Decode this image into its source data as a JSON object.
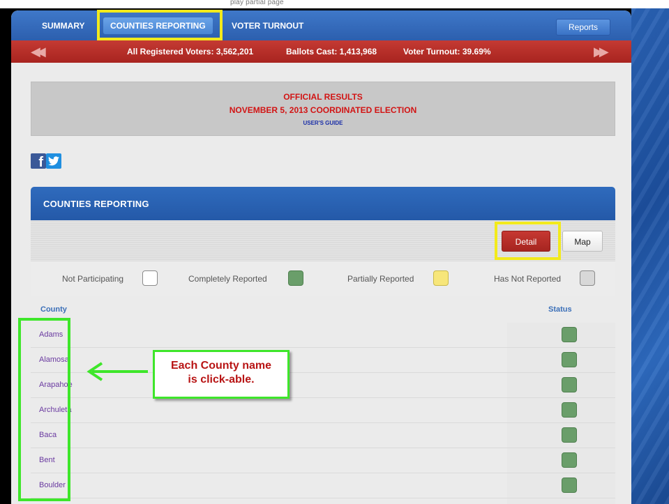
{
  "top_snippet": "play                                     partial page",
  "nav": {
    "items": [
      {
        "label": "SUMMARY"
      },
      {
        "label": "COUNTIES REPORTING"
      },
      {
        "label": "VOTER TURNOUT"
      }
    ],
    "active_index": 1,
    "reports_label": "Reports"
  },
  "stats_bar": {
    "registered": "All Registered Voters: 3,562,201",
    "ballots": "Ballots Cast: 1,413,968",
    "turnout": "Voter Turnout: 39.69%"
  },
  "banner": {
    "line1": "OFFICIAL RESULTS",
    "line2": "NOVEMBER 5, 2013 COORDINATED ELECTION",
    "guide": "USER'S GUIDE"
  },
  "counties_panel": {
    "title": "COUNTIES REPORTING",
    "detail_label": "Detail",
    "map_label": "Map",
    "legend": [
      {
        "label": "Not Participating",
        "color": "#ffffff"
      },
      {
        "label": "Completely Reported",
        "color": "#6a9e6a"
      },
      {
        "label": "Partially Reported",
        "color": "#f7e67a"
      },
      {
        "label": "Has Not Reported",
        "color": "#d8d8d8"
      }
    ],
    "col_county": "County",
    "col_status": "Status",
    "rows": [
      {
        "county": "Adams",
        "status": "Completely Reported"
      },
      {
        "county": "Alamosa",
        "status": "Completely Reported"
      },
      {
        "county": "Arapahoe",
        "status": "Completely Reported"
      },
      {
        "county": "Archuleta",
        "status": "Completely Reported"
      },
      {
        "county": "Baca",
        "status": "Completely Reported"
      },
      {
        "county": "Bent",
        "status": "Completely Reported"
      },
      {
        "county": "Boulder",
        "status": "Completely Reported"
      }
    ]
  },
  "callout": {
    "line1": "Each County name",
    "line2": "is click-able."
  },
  "colors": {
    "nav_blue": "#2c5fae",
    "stats_red": "#b02a25",
    "highlight_yellow": "#f2ea1c",
    "highlight_green": "#3ee62a"
  }
}
